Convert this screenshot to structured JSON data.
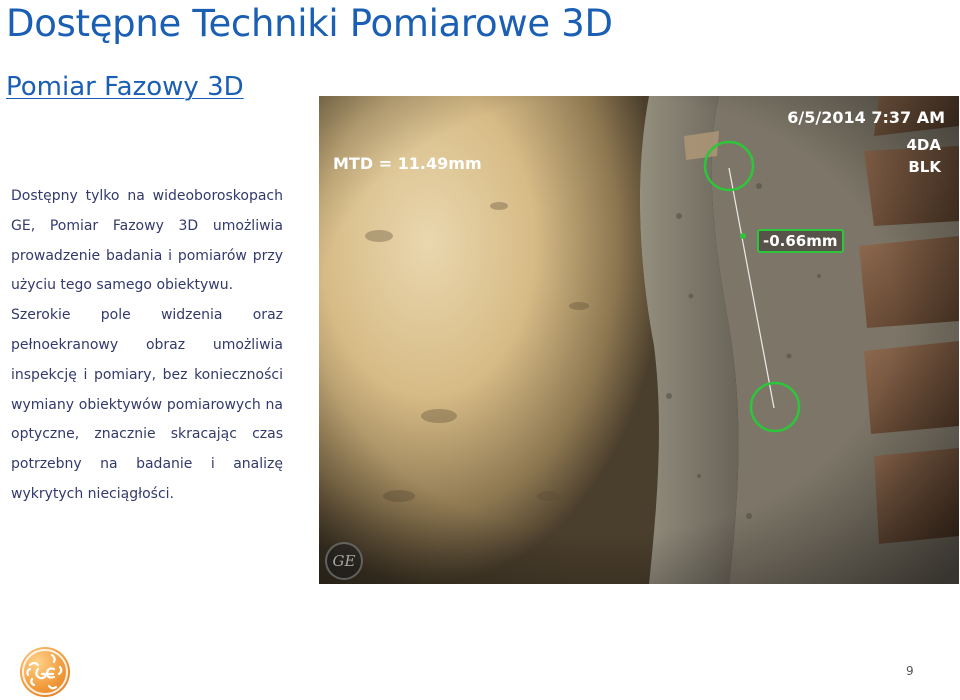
{
  "slide": {
    "title": "Dostępne Techniki Pomiarowe 3D",
    "subtitle": "Pomiar Fazowy 3D",
    "paragraph1": "Dostępny tylko na wideoboroskopach GE, Pomiar Fazowy 3D umożliwia prowadzenie badania i pomiarów przy użyciu tego samego obiektywu.",
    "paragraph2": "Szerokie pole widzenia oraz pełnoekranowy obraz umożliwia inspekcję i pomiary, bez konieczności wymiany obiektywów pomiarowych na optyczne, znacznie skracając czas potrzebny na badanie i analizę wykrytych nieciągłości.",
    "page_number": "9"
  },
  "inspection_image": {
    "datetime": "6/5/2014  7:37 AM",
    "mtd": "MTD = 11.49mm",
    "mode_line1": "4DA",
    "mode_line2": "BLK",
    "depth_reading": "-0.66mm",
    "watermark_text": "GE",
    "cursor_color": "#2dc63a"
  },
  "colors": {
    "title_blue": "#1a5fb4",
    "body_text": "#333a6b",
    "logo_orange": "#f19a3a"
  }
}
